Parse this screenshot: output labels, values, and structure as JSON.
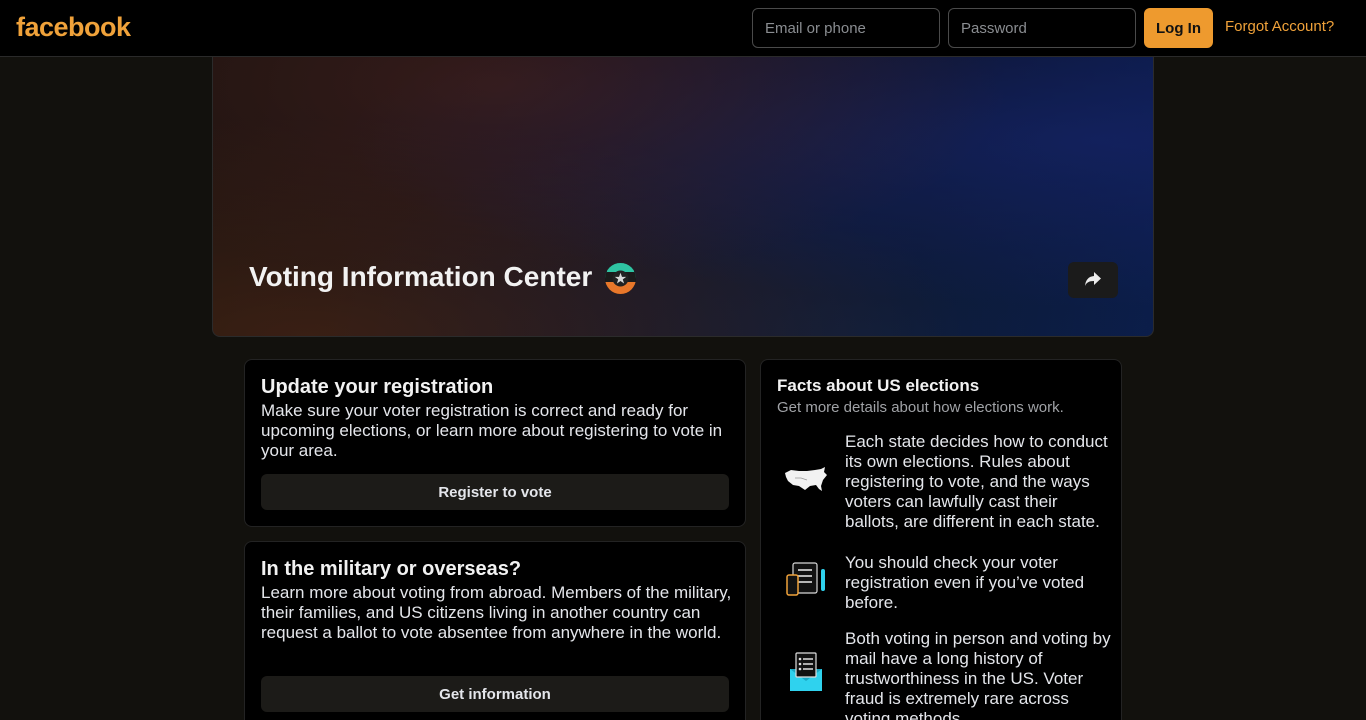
{
  "header": {
    "logo": "facebook",
    "email_placeholder": "Email or phone",
    "password_placeholder": "Password",
    "login_label": "Log In",
    "forgot_label": "Forgot Account?"
  },
  "hero": {
    "title": "Voting Information Center",
    "badge_icon": "voting-star-badge-icon",
    "share_icon": "share-arrow-icon"
  },
  "cards": {
    "register": {
      "title": "Update your registration",
      "description": "Make sure your voter registration is correct and ready for upcoming elections, or learn more about registering to vote in your area.",
      "button": "Register to vote"
    },
    "military": {
      "title": "In the military or overseas?",
      "description": "Learn more about voting from abroad. Members of the military, their families, and US citizens living in another country can request a ballot to vote absentee from anywhere in the world.",
      "button": "Get information"
    }
  },
  "facts": {
    "title": "Facts about US elections",
    "subtitle": "Get more details about how elections work.",
    "items": [
      {
        "icon": "us-map-icon",
        "text": "Each state decides how to conduct its own elections. Rules about registering to vote, and the ways voters can lawfully cast their ballots, are different in each state."
      },
      {
        "icon": "phone-checklist-icon",
        "text": "You should check your voter registration even if you’ve voted before."
      },
      {
        "icon": "mail-ballot-icon",
        "text": "Both voting in person and voting by mail have a long history of trustworthiness in the US. Voter fraud is extremely rare across voting methods."
      }
    ]
  },
  "colors": {
    "accent": "#ee9a2e",
    "background": "#12110d",
    "card": "#000000",
    "button": "#1c1b18"
  }
}
